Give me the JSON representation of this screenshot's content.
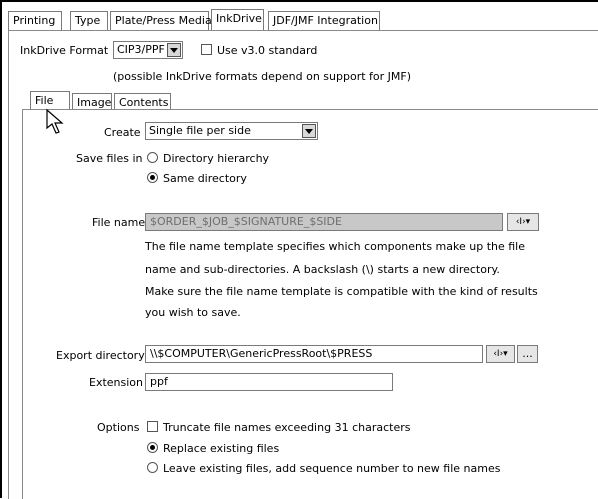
{
  "tabs": [
    {
      "label": "Printing"
    },
    {
      "label": "Type"
    },
    {
      "label": "Plate/Press Media"
    },
    {
      "label": "InkDrive"
    },
    {
      "label": "JDF/JMF Integration"
    }
  ],
  "inkdrive": {
    "format_label": "InkDrive Format",
    "format_value": "CIP3/PPF",
    "v3_label": "Use v3.0 standard",
    "v3_checked": false,
    "note": "(possible InkDrive formats depend on support for JMF)"
  },
  "subtabs": [
    {
      "label": "File"
    },
    {
      "label": "Image"
    },
    {
      "label": "Contents"
    }
  ],
  "file": {
    "create_label": "Create",
    "create_value": "Single file per side",
    "save_label": "Save files in",
    "save_opt_1": "Directory hierarchy",
    "save_opt_2": "Same directory",
    "save_selected": "Same directory",
    "filename_label": "File name",
    "filename_value": "$ORDER_$JOB_$SIGNATURE_$SIDE",
    "desc_1": "The file name template specifies which components make up the file",
    "desc_2": "name and sub-directories. A backslash (\\) starts a new directory.",
    "desc_3": "Make sure the file name template is compatible with the kind of results",
    "desc_4": "you wish to save.",
    "export_label": "Export directory",
    "export_value": "\\\\$COMPUTER\\GenericPressRoot\\$PRESS",
    "browse_label": "...",
    "ext_label": "Extension",
    "ext_value": "ppf",
    "options_label": "Options",
    "opt_truncate": "Truncate file names exceeding 31 characters",
    "opt_replace": "Replace existing files",
    "opt_leave": "Leave existing files, add sequence number to new file names",
    "opt_selected": "Replace existing files"
  },
  "icons": {
    "variable_insert": "variable-insert-icon",
    "dropdown": "chevron-down-icon",
    "cursor": "mouse-pointer-icon"
  },
  "colors": {
    "background": "#ffffff",
    "disabled_field": "#c8c8c8",
    "border": "#7a7a7a"
  }
}
